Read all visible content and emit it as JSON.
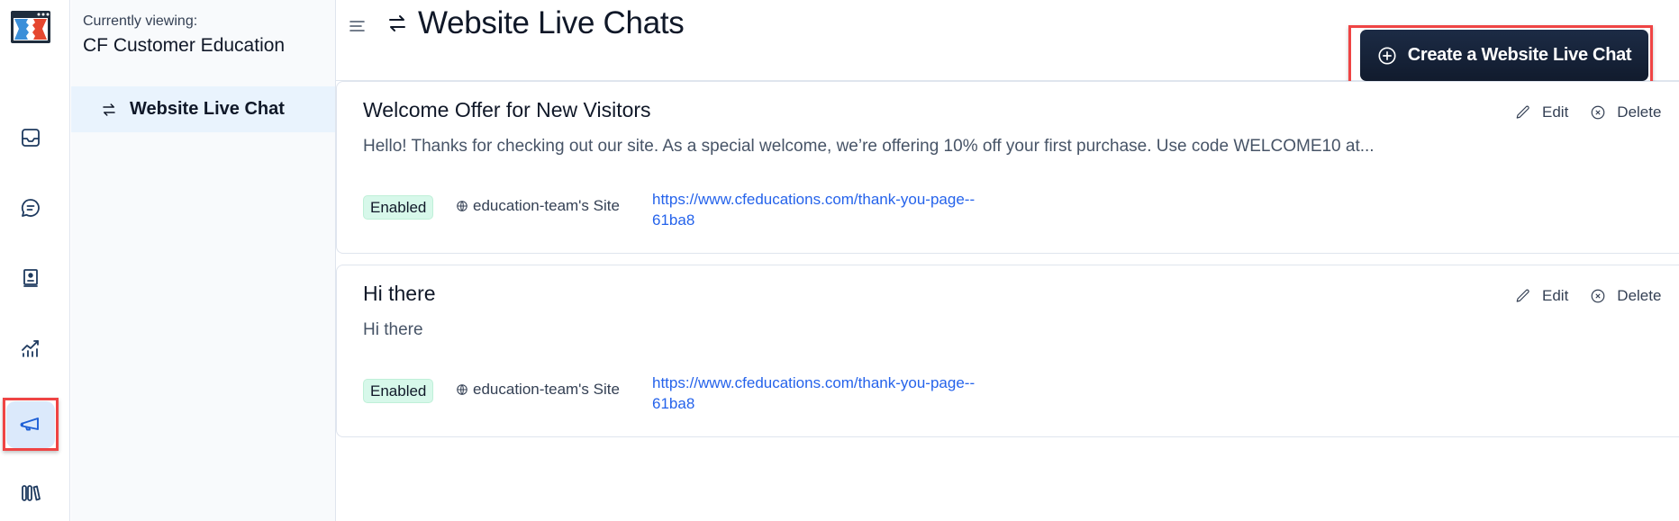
{
  "app": {
    "logo": "clickfunnels-logo"
  },
  "rail": {
    "items": [
      {
        "name": "inbox",
        "icon": "inbox-icon",
        "active": false
      },
      {
        "name": "chat",
        "icon": "chat-bubble-icon",
        "active": false
      },
      {
        "name": "contacts",
        "icon": "contact-book-icon",
        "active": false
      },
      {
        "name": "analytics",
        "icon": "chart-trend-icon",
        "active": false
      },
      {
        "name": "marketing",
        "icon": "megaphone-icon",
        "active": true
      },
      {
        "name": "library",
        "icon": "library-icon",
        "active": false
      }
    ]
  },
  "subnav": {
    "viewing_label": "Currently viewing:",
    "viewing_name": "CF Customer Education",
    "items": [
      {
        "label": "Website Live Chat",
        "icon": "arrows-swap-icon",
        "active": true
      }
    ]
  },
  "header": {
    "title": "Website Live Chats",
    "create_button_label": "Create a Website Live Chat"
  },
  "chats": [
    {
      "title": "Welcome Offer for New Visitors",
      "description": "Hello! Thanks for checking out our site. As a special welcome, we’re offering 10% off your first purchase. Use code WELCOME10 at...",
      "status": "Enabled",
      "site": "education-team's Site",
      "url": "https://www.cfeducations.com/thank-you-page--61ba8",
      "edit_label": "Edit",
      "delete_label": "Delete"
    },
    {
      "title": "Hi there",
      "description": "Hi there",
      "status": "Enabled",
      "site": "education-team's Site",
      "url": "https://www.cfeducations.com/thank-you-page--61ba8",
      "edit_label": "Edit",
      "delete_label": "Delete"
    }
  ],
  "colors": {
    "primary_button": "#1c2b45",
    "active_nav": "#dbe9fb",
    "link": "#2563eb",
    "enabled_badge": "#d7f8ea",
    "highlight": "#ef4444"
  }
}
